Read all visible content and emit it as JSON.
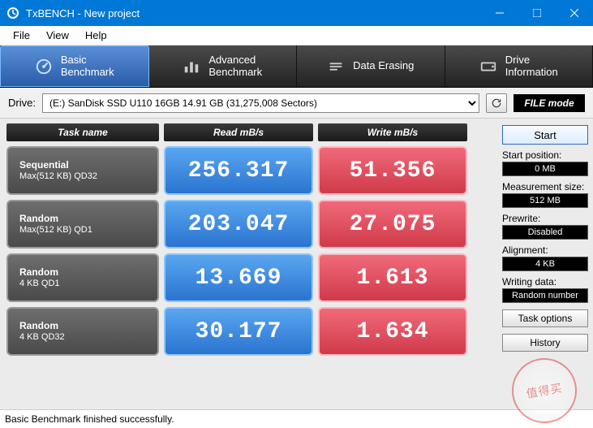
{
  "window": {
    "title": "TxBENCH - New project",
    "menu": [
      "File",
      "View",
      "Help"
    ]
  },
  "tabs": [
    {
      "line1": "Basic",
      "line2": "Benchmark",
      "active": true
    },
    {
      "line1": "Advanced",
      "line2": "Benchmark"
    },
    {
      "line1": "Data Erasing",
      "line2": ""
    },
    {
      "line1": "Drive",
      "line2": "Information"
    }
  ],
  "toolbar": {
    "drive_label": "Drive:",
    "drive_value": "(E:) SanDisk SSD U110 16GB  14.91 GB (31,275,008 Sectors)",
    "filemode": "FILE mode"
  },
  "headers": {
    "task": "Task name",
    "read": "Read mB/s",
    "write": "Write mB/s"
  },
  "rows": [
    {
      "name": "Sequential",
      "sub": "Max(512 KB) QD32",
      "read": "256.317",
      "write": "51.356"
    },
    {
      "name": "Random",
      "sub": "Max(512 KB) QD1",
      "read": "203.047",
      "write": "27.075"
    },
    {
      "name": "Random",
      "sub": "4 KB QD1",
      "read": "13.669",
      "write": "1.613"
    },
    {
      "name": "Random",
      "sub": "4 KB QD32",
      "read": "30.177",
      "write": "1.634"
    }
  ],
  "sidebar": {
    "start": "Start",
    "groups": [
      {
        "label": "Start position:",
        "value": "0 MB"
      },
      {
        "label": "Measurement size:",
        "value": "512 MB"
      },
      {
        "label": "Prewrite:",
        "value": "Disabled"
      },
      {
        "label": "Alignment:",
        "value": "4 KB"
      },
      {
        "label": "Writing data:",
        "value": "Random number"
      }
    ],
    "task_options": "Task options",
    "history": "History"
  },
  "status": "Basic Benchmark finished successfully.",
  "watermark": "值得买"
}
